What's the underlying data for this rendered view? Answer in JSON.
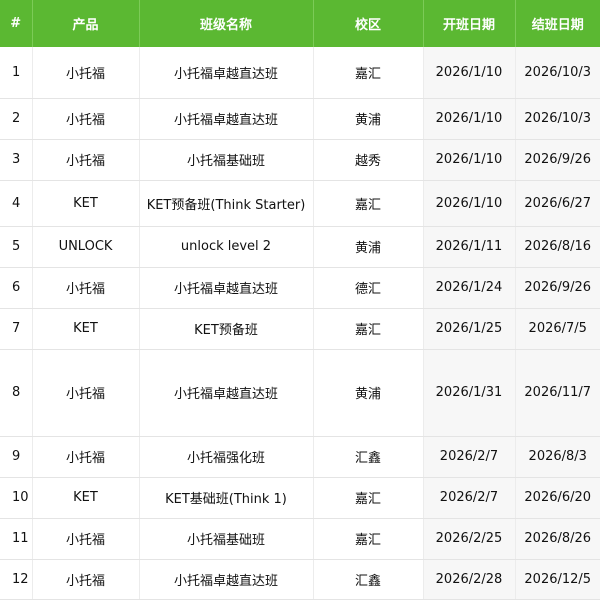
{
  "headers": [
    "#",
    "产品",
    "班级名称",
    "校区",
    "开班日期",
    "结班日期"
  ],
  "colors": {
    "header_bg": "#5bb832",
    "header_text": "#ffffff",
    "date_cell_bg": "#f7f7f7"
  },
  "rows": [
    {
      "no": "1",
      "product": "小托福",
      "class_name": "小托福卓越直达班",
      "campus": "嘉汇",
      "start": "2026/1/10",
      "end": "2026/10/3"
    },
    {
      "no": "2",
      "product": "小托福",
      "class_name": "小托福卓越直达班",
      "campus": "黄浦",
      "start": "2026/1/10",
      "end": "2026/10/3"
    },
    {
      "no": "3",
      "product": "小托福",
      "class_name": "小托福基础班",
      "campus": "越秀",
      "start": "2026/1/10",
      "end": "2026/9/26"
    },
    {
      "no": "4",
      "product": "KET",
      "class_name": "KET预备班(Think Starter)",
      "campus": "嘉汇",
      "start": "2026/1/10",
      "end": "2026/6/27"
    },
    {
      "no": "5",
      "product": "UNLOCK",
      "class_name": "unlock level 2",
      "campus": "黄浦",
      "start": "2026/1/11",
      "end": "2026/8/16"
    },
    {
      "no": "6",
      "product": "小托福",
      "class_name": "小托福卓越直达班",
      "campus": "德汇",
      "start": "2026/1/24",
      "end": "2026/9/26"
    },
    {
      "no": "7",
      "product": "KET",
      "class_name": "KET预备班",
      "campus": "嘉汇",
      "start": "2026/1/25",
      "end": "2026/7/5"
    },
    {
      "no": "8",
      "product": "小托福",
      "class_name": "小托福卓越直达班",
      "campus": "黄浦",
      "start": "2026/1/31",
      "end": "2026/11/7"
    },
    {
      "no": "9",
      "product": "小托福",
      "class_name": "小托福强化班",
      "campus": "汇鑫",
      "start": "2026/2/7",
      "end": "2026/8/3"
    },
    {
      "no": "10",
      "product": "KET",
      "class_name": "KET基础班(Think 1)",
      "campus": "嘉汇",
      "start": "2026/2/7",
      "end": "2026/6/20"
    },
    {
      "no": "11",
      "product": "小托福",
      "class_name": "小托福基础班",
      "campus": "嘉汇",
      "start": "2026/2/25",
      "end": "2026/8/26"
    },
    {
      "no": "12",
      "product": "小托福",
      "class_name": "小托福卓越直达班",
      "campus": "汇鑫",
      "start": "2026/2/28",
      "end": "2026/12/5"
    }
  ]
}
